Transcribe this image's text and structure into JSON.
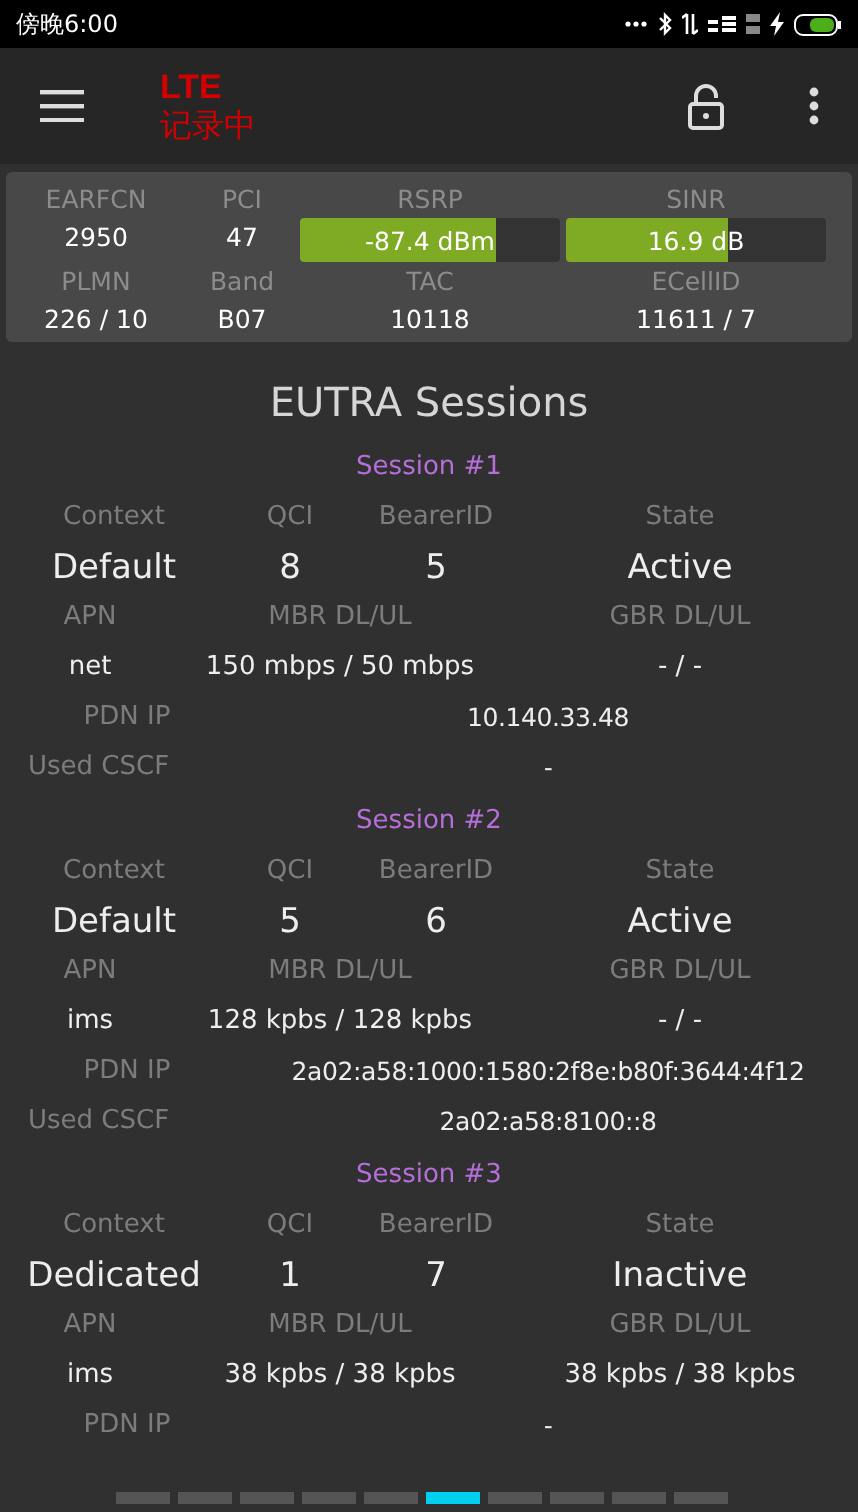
{
  "status_bar": {
    "time": "傍晚6:00"
  },
  "app_bar": {
    "title": "LTE",
    "subtitle": "记录中"
  },
  "cell_info": {
    "row_1": [
      {
        "label": "EARFCN",
        "value": "2950",
        "kind": "text"
      },
      {
        "label": "PCI",
        "value": "47",
        "kind": "text"
      },
      {
        "label": "RSRP",
        "value": "-87.4 dBm",
        "kind": "meter",
        "level": 0.75
      },
      {
        "label": "SINR",
        "value": "16.9 dB",
        "kind": "meter",
        "level": 0.62
      }
    ],
    "row_2": [
      {
        "label": "PLMN",
        "value": "226 / 10"
      },
      {
        "label": "Band",
        "value": "B07"
      },
      {
        "label": "TAC",
        "value": "10118"
      },
      {
        "label": "ECellID",
        "value": "11611 / 7"
      }
    ]
  },
  "heading": "EUTRA Sessions",
  "sessions": [
    {
      "title": "Session #1",
      "context_label": "Context",
      "qci_label": "QCI",
      "bearer_label": "BearerID",
      "state_label": "State",
      "context": "Default",
      "qci": "8",
      "bearer_id": "5",
      "state": "Active",
      "apn_label": "APN",
      "mbr_label": "MBR DL/UL",
      "gbr_label": "GBR DL/UL",
      "apn": "net",
      "mbr": "150 mbps / 50 mbps",
      "gbr": "- / -",
      "pdn_ip_label": "PDN IP",
      "pdn_ip": "10.140.33.48",
      "cscf_label": "Used CSCF",
      "cscf": "-"
    },
    {
      "title": "Session #2",
      "context_label": "Context",
      "qci_label": "QCI",
      "bearer_label": "BearerID",
      "state_label": "State",
      "context": "Default",
      "qci": "5",
      "bearer_id": "6",
      "state": "Active",
      "apn_label": "APN",
      "mbr_label": "MBR DL/UL",
      "gbr_label": "GBR DL/UL",
      "apn": "ims",
      "mbr": "128 kpbs / 128 kpbs",
      "gbr": "- / -",
      "pdn_ip_label": "PDN IP",
      "pdn_ip": "2a02:a58:1000:1580:2f8e:b80f:3644:4f12",
      "cscf_label": "Used CSCF",
      "cscf": "2a02:a58:8100::8"
    },
    {
      "title": "Session #3",
      "context_label": "Context",
      "qci_label": "QCI",
      "bearer_label": "BearerID",
      "state_label": "State",
      "context": "Dedicated",
      "qci": "1",
      "bearer_id": "7",
      "state": "Inactive",
      "apn_label": "APN",
      "mbr_label": "MBR DL/UL",
      "gbr_label": "GBR DL/UL",
      "apn": "ims",
      "mbr": "38 kpbs / 38 kpbs",
      "gbr": "38 kpbs / 38 kpbs",
      "pdn_ip_label": "PDN IP",
      "pdn_ip": "-"
    }
  ],
  "page_indicator": [
    {
      "selected": false
    },
    {
      "selected": false
    },
    {
      "selected": false
    },
    {
      "selected": false
    },
    {
      "selected": false
    },
    {
      "selected": true
    },
    {
      "selected": false
    },
    {
      "selected": false
    },
    {
      "selected": false
    },
    {
      "selected": false
    }
  ]
}
